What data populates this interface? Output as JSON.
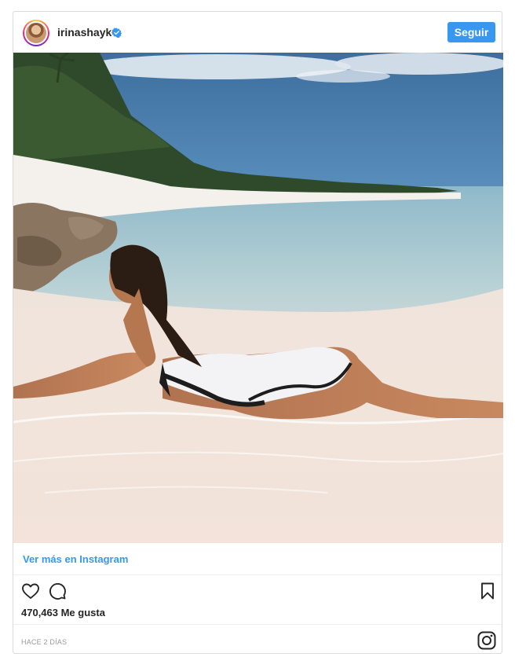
{
  "header": {
    "username": "irinashayk",
    "verified": true,
    "follow_label": "Seguir"
  },
  "post": {
    "view_more_label": "Ver más en Instagram",
    "likes_text": "470,463 Me gusta",
    "timestamp": "HACE 2 DÍAS"
  },
  "icons": {
    "like": "heart-icon",
    "comment": "comment-icon",
    "save": "bookmark-icon",
    "brand": "instagram-logo-icon",
    "verified": "verified-badge-icon"
  },
  "colors": {
    "accent": "#3897f0",
    "text": "#262626",
    "muted": "#999999",
    "border": "#dbdbdb"
  }
}
